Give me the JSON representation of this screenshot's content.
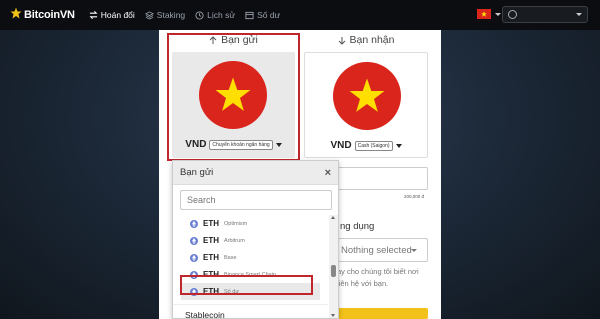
{
  "brand": {
    "name": "BitcoinVN",
    "icon": "star-logo-icon",
    "accent": "#f2c21a"
  },
  "nav": {
    "items": [
      {
        "label": "Hoán đổi",
        "icon": "swap-icon",
        "active": true
      },
      {
        "label": "Staking",
        "icon": "layers-icon",
        "active": false
      },
      {
        "label": "Lịch sử",
        "icon": "history-icon",
        "active": false
      },
      {
        "label": "Số dư",
        "icon": "wallet-icon",
        "active": false
      }
    ],
    "language_flag": "vietnam-flag-icon",
    "account": ""
  },
  "exchange": {
    "send": {
      "heading": "Bạn gửi",
      "currency": "VND",
      "method": "Chuyển khoản ngân hàng"
    },
    "receive": {
      "heading": "Bạn nhận",
      "currency": "VND",
      "method": "Cash (Saigon)"
    },
    "amount_hint": "200,000 đ",
    "bank_label": "ng dụng",
    "bank_select": "Nothing selected",
    "help_line1": "ay cho chúng tôi biết nơi",
    "help_line2": "liên hệ với bạn."
  },
  "dropdown": {
    "title": "Bạn gửi",
    "close": "×",
    "search_placeholder": "Search",
    "items": [
      {
        "code": "ETH",
        "network": "Optimism"
      },
      {
        "code": "ETH",
        "network": "Arbitrum"
      },
      {
        "code": "ETH",
        "network": "Base"
      },
      {
        "code": "ETH",
        "network": "Binance Smart Chain"
      },
      {
        "code": "ETH",
        "network": "Số dư",
        "selected": true
      }
    ],
    "group": "Stablecoin"
  },
  "colors": {
    "highlight": "#c0272d",
    "flag_red": "#da251d",
    "flag_star": "#ffde00"
  }
}
